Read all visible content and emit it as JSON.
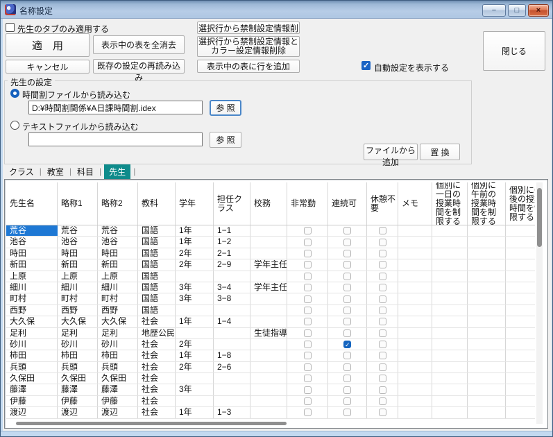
{
  "window": {
    "title": "名称設定",
    "minimize_glyph": "−",
    "maximize_glyph": "□",
    "close_glyph": "×"
  },
  "toolbar": {
    "teacher_tab_only": "先生のタブのみ適用する",
    "apply": "適　用",
    "cancel": "キャンセル",
    "clear_table": "表示中の表を全消去",
    "reload": "既存の設定の再読み込み",
    "delete_info": "選択行から禁制設定情報削除",
    "delete_info_color_line1": "選択行から禁制設定情報と",
    "delete_info_color_line2": "カラー設定情報削除",
    "add_row": "表示中の表に行を追加",
    "auto_show": "自動設定を表示する",
    "close": "閉じる"
  },
  "teacher_settings": {
    "group_label": "先生の設定",
    "radio_timetable": "時間割ファイルから読み込む",
    "path1": "D:¥時間割関係¥A日課時間割.idex",
    "browse1": "参 照",
    "radio_text": "テキストファイルから読み込む",
    "path2": "",
    "browse2": "参 照",
    "add_from_file": "ファイルから追加",
    "replace": "置 換"
  },
  "tabs": {
    "items": [
      "クラス",
      "教室",
      "科目",
      "先生"
    ],
    "active": "先生"
  },
  "colors": {
    "tab_active": "#0e8b8b",
    "selection": "#1e78d4",
    "checked_blue": "#1565c0"
  },
  "table": {
    "columns": [
      "先生名",
      "略称1",
      "略称2",
      "教科",
      "学年",
      "担任クラス",
      "校務",
      "非常勤",
      "連続可",
      "休憩不要",
      "メモ",
      "個別に一日の授業時間を制限する",
      "個別に午前の授業時間を制限する",
      "個別に午後の授業時間を制限する"
    ],
    "selected": {
      "row": 0,
      "col": 0
    },
    "rows": [
      {
        "cells": [
          "荒谷",
          "荒谷",
          "荒谷",
          "国語",
          "1年",
          "1−1",
          ""
        ],
        "checks": [
          false,
          false,
          false
        ]
      },
      {
        "cells": [
          "池谷",
          "池谷",
          "池谷",
          "国語",
          "1年",
          "1−2",
          ""
        ],
        "checks": [
          false,
          false,
          false
        ]
      },
      {
        "cells": [
          "時田",
          "時田",
          "時田",
          "国語",
          "2年",
          "2−1",
          ""
        ],
        "checks": [
          false,
          false,
          false
        ]
      },
      {
        "cells": [
          "新田",
          "新田",
          "新田",
          "国語",
          "2年",
          "2−9",
          "学年主任"
        ],
        "checks": [
          false,
          false,
          false
        ]
      },
      {
        "cells": [
          "上原",
          "上原",
          "上原",
          "国語",
          "",
          "",
          ""
        ],
        "checks": [
          false,
          false,
          false
        ]
      },
      {
        "cells": [
          "細川",
          "細川",
          "細川",
          "国語",
          "3年",
          "3−4",
          "学年主任"
        ],
        "checks": [
          false,
          false,
          false
        ]
      },
      {
        "cells": [
          "町村",
          "町村",
          "町村",
          "国語",
          "3年",
          "3−8",
          ""
        ],
        "checks": [
          false,
          false,
          false
        ]
      },
      {
        "cells": [
          "西野",
          "西野",
          "西野",
          "国語",
          "",
          "",
          ""
        ],
        "checks": [
          false,
          false,
          false
        ]
      },
      {
        "cells": [
          "大久保",
          "大久保",
          "大久保",
          "社会",
          "1年",
          "1−4",
          ""
        ],
        "checks": [
          false,
          false,
          false
        ]
      },
      {
        "cells": [
          "足利",
          "足利",
          "足利",
          "地歴公民",
          "",
          "",
          "生徒指導"
        ],
        "checks": [
          false,
          false,
          false
        ]
      },
      {
        "cells": [
          "砂川",
          "砂川",
          "砂川",
          "社会",
          "2年",
          "",
          ""
        ],
        "checks": [
          false,
          true,
          false
        ]
      },
      {
        "cells": [
          "柿田",
          "柿田",
          "柿田",
          "社会",
          "1年",
          "1−8",
          ""
        ],
        "checks": [
          false,
          false,
          false
        ]
      },
      {
        "cells": [
          "兵頭",
          "兵頭",
          "兵頭",
          "社会",
          "2年",
          "2−6",
          ""
        ],
        "checks": [
          false,
          false,
          false
        ]
      },
      {
        "cells": [
          "久保田",
          "久保田",
          "久保田",
          "社会",
          "",
          "",
          ""
        ],
        "checks": [
          false,
          false,
          false
        ]
      },
      {
        "cells": [
          "藤澤",
          "藤澤",
          "藤澤",
          "社会",
          "3年",
          "",
          ""
        ],
        "checks": [
          false,
          false,
          false
        ]
      },
      {
        "cells": [
          "伊藤",
          "伊藤",
          "伊藤",
          "社会",
          "",
          "",
          ""
        ],
        "checks": [
          false,
          false,
          false
        ]
      },
      {
        "cells": [
          "渡辺",
          "渡辺",
          "渡辺",
          "社会",
          "1年",
          "1−3",
          ""
        ],
        "checks": [
          false,
          false,
          false
        ]
      }
    ]
  }
}
